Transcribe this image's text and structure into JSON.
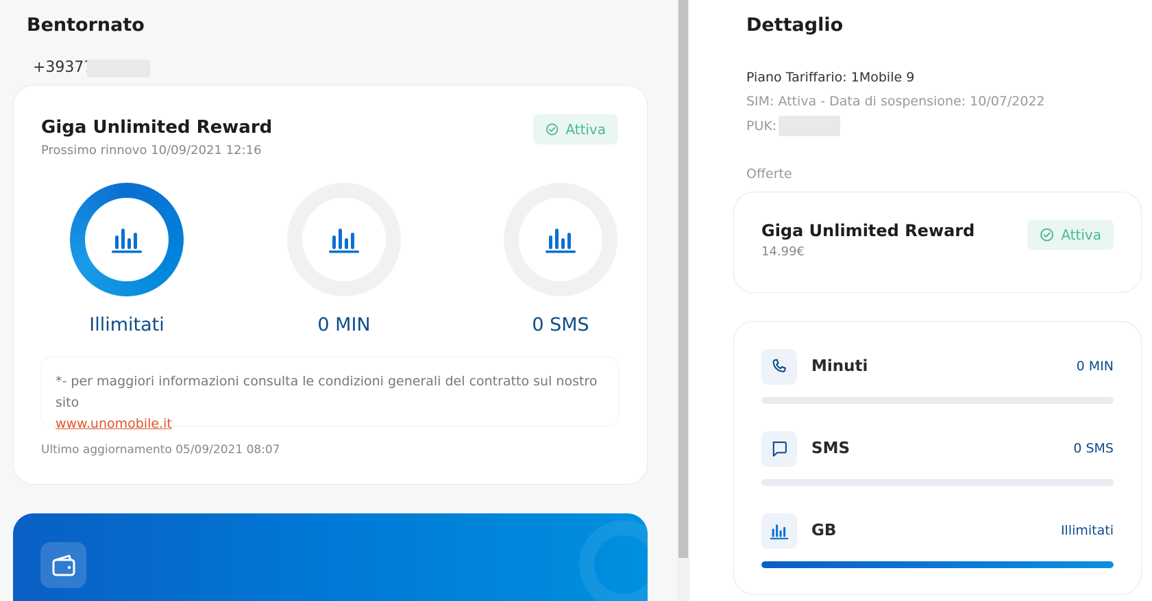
{
  "left": {
    "welcome": "Bentornato",
    "phone_prefix": "+39377",
    "plan": {
      "title": "Giga Unlimited Reward",
      "renewal": "Prossimo rinnovo 10/09/2021 12:16",
      "status": "Attiva"
    },
    "meters": [
      {
        "label": "Illimitati",
        "fill": 1.0
      },
      {
        "label": "0 MIN",
        "fill": 0
      },
      {
        "label": "0 SMS",
        "fill": 0
      }
    ],
    "info_text": "*- per maggiori informazioni consulta le condizioni generali del contratto sul nostro sito",
    "info_link": "www.unomobile.it",
    "updated": "Ultimo aggiornamento 05/09/2021 08:07"
  },
  "detail": {
    "title": "Dettaglio",
    "tariff": "Piano Tariffario: 1Mobile 9",
    "sim": "SIM: Attiva - Data di sospensione: 10/07/2022",
    "puk_label": "PUK:",
    "offers_label": "Offerte",
    "offer": {
      "title": "Giga Unlimited Reward",
      "price": "14.99€",
      "status": "Attiva"
    },
    "usage": [
      {
        "name": "Minuti",
        "value": "0 MIN",
        "icon": "phone-icon",
        "fill": 0
      },
      {
        "name": "SMS",
        "value": "0 SMS",
        "icon": "message-icon",
        "fill": 0
      },
      {
        "name": "GB",
        "value": "Illimitati",
        "icon": "bar-chart-icon",
        "fill": 1.0
      }
    ]
  },
  "colors": {
    "brand_blue": "#0079d6",
    "dark_blue": "#0d4c8c",
    "active_green": "#4cb98f",
    "link_orange": "#e2552b"
  }
}
